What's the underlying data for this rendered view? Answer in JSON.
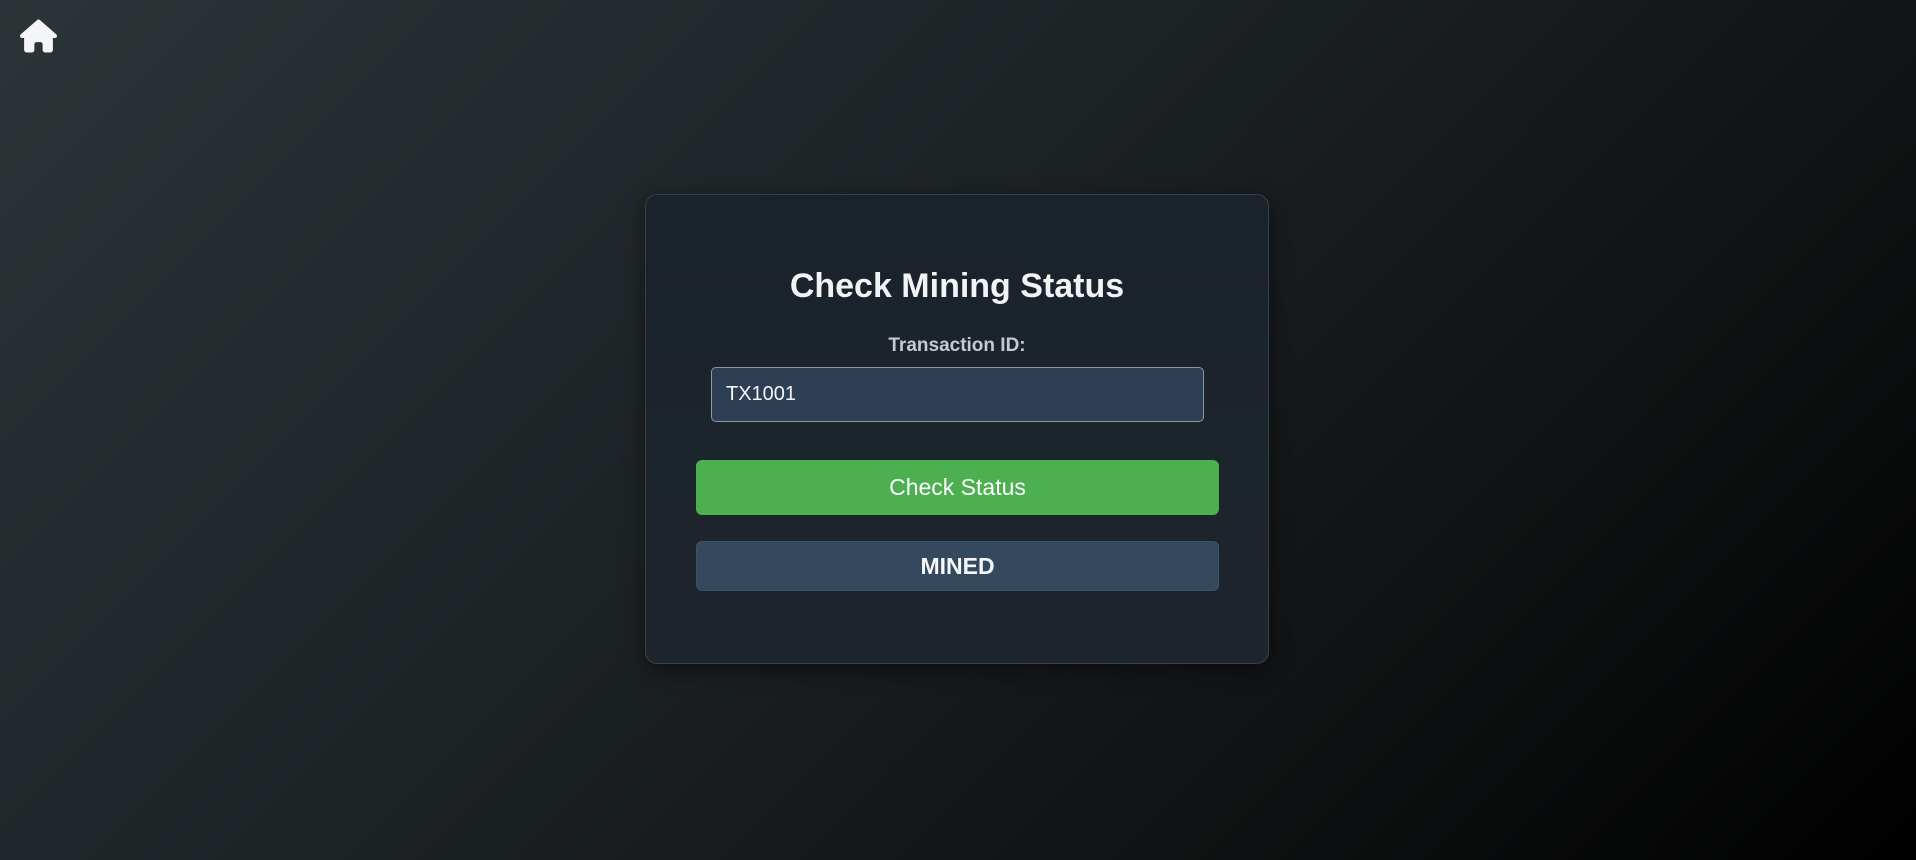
{
  "nav": {
    "home_icon": "home-icon"
  },
  "form": {
    "title": "Check Mining Status",
    "transaction_label": "Transaction ID:",
    "transaction_value": "TX1001",
    "check_button_label": "Check Status"
  },
  "result": {
    "status": "MINED"
  },
  "colors": {
    "button": "#4caf50",
    "status_bg": "#34495e",
    "input_bg": "#2e3f55",
    "card_bg": "#1e252d"
  }
}
